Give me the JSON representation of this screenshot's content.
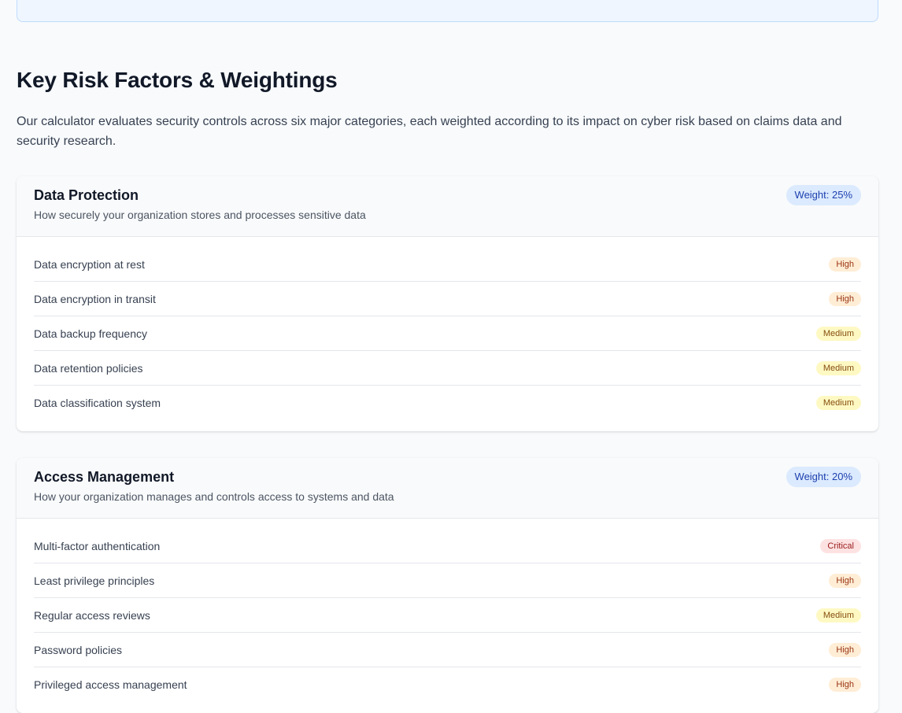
{
  "section": {
    "title": "Key Risk Factors & Weightings",
    "intro": "Our calculator evaluates security controls across six major categories, each weighted according to its impact on cyber risk based on claims data and security research."
  },
  "categories": [
    {
      "title": "Data Protection",
      "description": "How securely your organization stores and processes sensitive data",
      "weight": "Weight: 25%",
      "factors": [
        {
          "name": "Data encryption at rest",
          "level": "High"
        },
        {
          "name": "Data encryption in transit",
          "level": "High"
        },
        {
          "name": "Data backup frequency",
          "level": "Medium"
        },
        {
          "name": "Data retention policies",
          "level": "Medium"
        },
        {
          "name": "Data classification system",
          "level": "Medium"
        }
      ]
    },
    {
      "title": "Access Management",
      "description": "How your organization manages and controls access to systems and data",
      "weight": "Weight: 20%",
      "factors": [
        {
          "name": "Multi-factor authentication",
          "level": "Critical"
        },
        {
          "name": "Least privilege principles",
          "level": "High"
        },
        {
          "name": "Regular access reviews",
          "level": "Medium"
        },
        {
          "name": "Password policies",
          "level": "High"
        },
        {
          "name": "Privileged access management",
          "level": "High"
        }
      ]
    }
  ],
  "colors": {
    "weight_badge_bg": "#dbeafe",
    "weight_badge_text": "#1e40af",
    "high_bg": "#ffedd5",
    "high_text": "#9a3412",
    "medium_bg": "#fef9c3",
    "medium_text": "#854d0e",
    "critical_bg": "#fee2e2",
    "critical_text": "#991b1b"
  }
}
